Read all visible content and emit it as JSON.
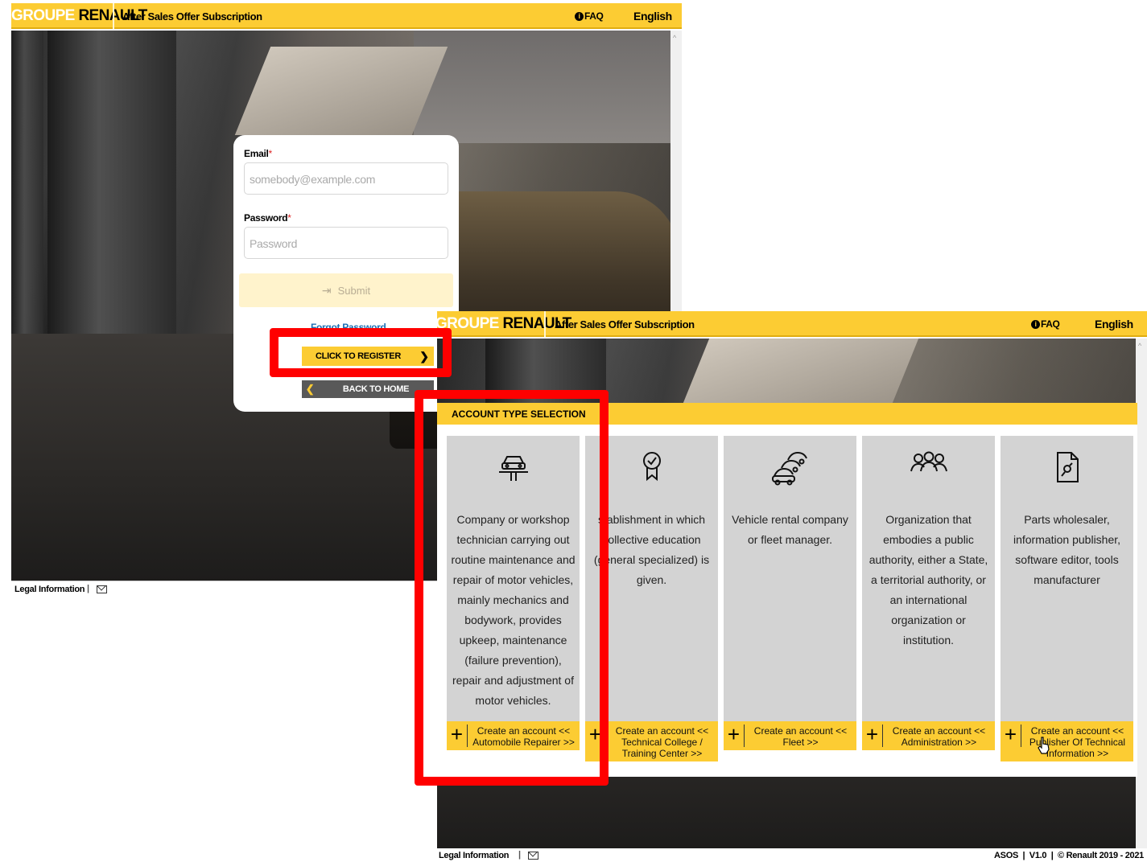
{
  "brand": {
    "groupe": "GROUPE",
    "renault": "RENAULT"
  },
  "app_title": "After Sales Offer Subscription",
  "faq": "FAQ",
  "language": "English",
  "login": {
    "email_label": "Email",
    "email_placeholder": "somebody@example.com",
    "password_label": "Password",
    "password_placeholder": "Password",
    "required_mark": "*",
    "submit": "Submit",
    "forgot_password": "Forgot Password",
    "register": "CLICK TO REGISTER",
    "back_home": "BACK TO HOME"
  },
  "footer": {
    "legal": "Legal Information",
    "separator": "|",
    "version_info": "ASOS  |  V1.0  |  © Renault 2019 - 2021"
  },
  "account_selection": {
    "title": "ACCOUNT TYPE SELECTION",
    "types": [
      {
        "icon": "car-lift-icon",
        "description": "Company or workshop technician carrying out routine maintenance and repair of motor vehicles, mainly mechanics and bodywork, provides upkeep, maintenance (failure prevention), repair and adjustment of motor vehicles.",
        "create": "Create an account << Automobile Repairer >>"
      },
      {
        "icon": "certificate-icon",
        "description": "stablishment in which collective education (general specialized) is given.",
        "create": "Create an account << Technical College / Training Center >>"
      },
      {
        "icon": "car-fleet-icon",
        "description": "Vehicle rental company or fleet manager.",
        "create": "Create an account << Fleet >>"
      },
      {
        "icon": "people-group-icon",
        "description": "Organization that embodies a public authority, either a State, a territorial authority, or an international organization or institution.",
        "create": "Create an account << Administration >>"
      },
      {
        "icon": "document-tool-icon",
        "description": "Parts wholesaler, information publisher, software editor, tools manufacturer",
        "create": "Create an account << Publisher Of Technical Information >>"
      }
    ]
  },
  "colors": {
    "brand_yellow": "#fccc33",
    "highlight_red": "#ff0000",
    "link_blue": "#1b6fb4"
  }
}
